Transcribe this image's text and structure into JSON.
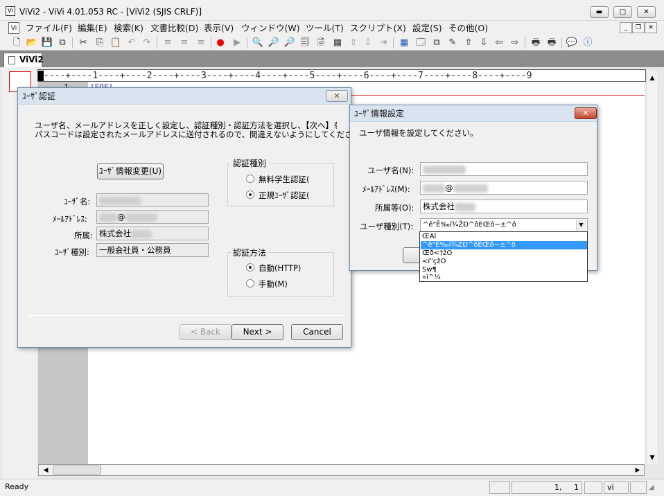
{
  "window": {
    "title": "ViVi2 - ViVi 4.01.053 RC - [ViVi2 (SJIS CRLF)]",
    "app_icon": "vivi-app-icon"
  },
  "menu": {
    "items": [
      "ファイル(F)",
      "編集(E)",
      "検索(K)",
      "文書比較(D)",
      "表示(V)",
      "ウィンドウ(W)",
      "ツール(T)",
      "スクリプト(X)",
      "設定(S)",
      "その他(O)"
    ]
  },
  "tab": {
    "label": "ViVi2"
  },
  "editor": {
    "ruler": "----+----1----+----2----+----3----+----4----+----5----+----6----+----7----+----8----+----9",
    "line_number": "1",
    "eof_marker": "[EOF]"
  },
  "auth_dialog": {
    "title": "ﾕｰｻﾞ認証",
    "instruction_line1": "ユーザ名、メールアドレスを正しく設定し、認証種別・認証方法を選択し、【次へ】を押してくだ",
    "instruction_line2": "パスコードは設定されたメールアドレスに送付されるので、間違えないようにしてください。",
    "change_user_button": "ﾕｰｻﾞ情報変更(U)",
    "user_name_label": "ﾕｰｻﾞ名:",
    "email_label": "ﾒｰﾙｱﾄﾞﾚｽ:",
    "email_at": "@",
    "affiliation_label": "所属:",
    "affiliation_value": "株式会社",
    "user_type_label": "ﾕｰｻﾞ種別:",
    "user_type_value": "一般会社員・公務員",
    "auth_type_group": "認証種別",
    "auth_type_options": [
      "無料学生認証(",
      "正規ﾕｰｻﾞ認証("
    ],
    "auth_type_selected": 1,
    "auth_method_group": "認証方法",
    "auth_method_options": [
      "自動(HTTP)",
      "手動(M)"
    ],
    "auth_method_selected": 0,
    "back_button": "< Back",
    "next_button": "Next >",
    "cancel_button": "Cancel"
  },
  "userinfo_dialog": {
    "title": "ﾕｰｻﾞ情報設定",
    "prompt": "ユーザ情報を設定してください。",
    "user_name_label": "ユーザ名(N):",
    "email_label": "ﾒｰﾙｱﾄﾞﾚｽ(M):",
    "email_at": "@",
    "affiliation_label": "所属等(O):",
    "affiliation_value": "株式会社",
    "user_type_label": "ユーザ種別(T):",
    "user_type_value": "^ê\"Ê‰ï¾ŽÐ^ôEŒô−±^ô",
    "dropdown_options": [
      "ŒÃl",
      "^ê\"Ê‰ï¾ŽÐ^ôEŒô−±^ô",
      "Œð<†žÖ",
      "<ï\"çžÖ",
      "Šw¶",
      "»ì^¼"
    ],
    "dropdown_selected": 1
  },
  "status": {
    "text": "Ready",
    "position": "1,     1",
    "mode": "vi"
  }
}
